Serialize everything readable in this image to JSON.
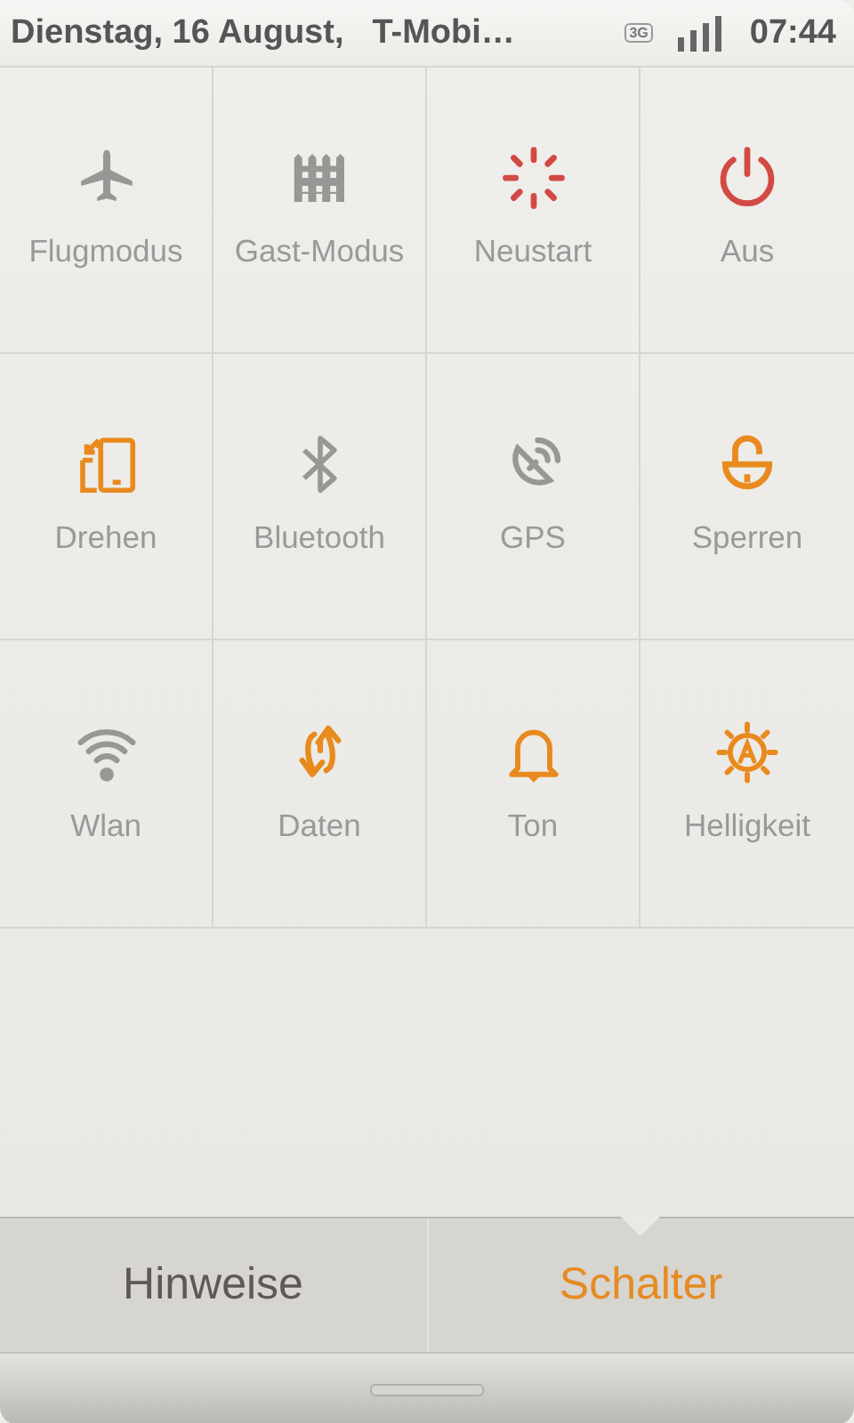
{
  "status_bar": {
    "date": "Dienstag, 16 August,",
    "carrier": "T-Mobi…",
    "network": "3G",
    "time": "07:44"
  },
  "toggles": [
    {
      "label": "Flugmodus",
      "kind": "airplane",
      "on": false,
      "warning": false
    },
    {
      "label": "Gast-Modus",
      "kind": "fence",
      "on": false,
      "warning": false
    },
    {
      "label": "Neustart",
      "kind": "spinner",
      "warning": true
    },
    {
      "label": "Aus",
      "kind": "power",
      "warning": true
    },
    {
      "label": "Drehen",
      "kind": "rotate",
      "on": true,
      "warning": false
    },
    {
      "label": "Bluetooth",
      "kind": "bluetooth",
      "on": false,
      "warning": false
    },
    {
      "label": "GPS",
      "kind": "gps",
      "on": false,
      "warning": false
    },
    {
      "label": "Sperren",
      "kind": "lock",
      "on": true,
      "warning": false
    },
    {
      "label": "Wlan",
      "kind": "wifi",
      "on": false,
      "warning": false
    },
    {
      "label": "Daten",
      "kind": "data",
      "on": true,
      "warning": false
    },
    {
      "label": "Ton",
      "kind": "bell",
      "on": true,
      "warning": false
    },
    {
      "label": "Helligkeit",
      "kind": "brightness",
      "on": true,
      "warning": false
    }
  ],
  "tabs": [
    {
      "label": "Hinweise",
      "selected": false
    },
    {
      "label": "Schalter",
      "selected": true
    }
  ]
}
